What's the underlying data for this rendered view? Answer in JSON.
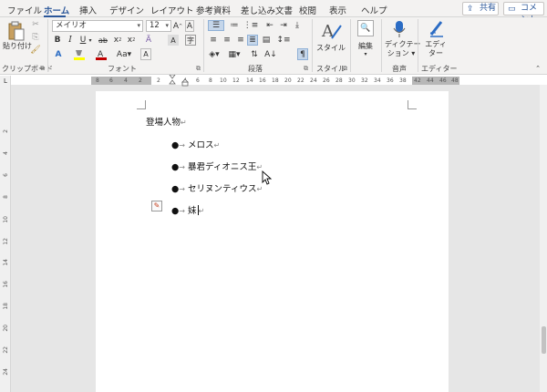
{
  "tabs": [
    "ファイル",
    "ホーム",
    "挿入",
    "デザイン",
    "レイアウト",
    "参考資料",
    "差し込み文書",
    "校閲",
    "表示",
    "ヘルプ"
  ],
  "active_tab": "ホーム",
  "share": {
    "label": "共有",
    "icon": "share-icon"
  },
  "comment": {
    "label": "コメント",
    "icon": "comment-icon"
  },
  "clipboard": {
    "paste_label": "貼り付け",
    "group_label": "クリップボード"
  },
  "font": {
    "name": "メイリオ",
    "size": "12",
    "group_label": "フォント"
  },
  "paragraph": {
    "group_label": "段落"
  },
  "styles": {
    "label": "スタイル",
    "group_label": "スタイル"
  },
  "editing": {
    "label": "編集"
  },
  "voice": {
    "label": "ディクテーション",
    "label_line1": "ディクテー",
    "label_line2": "ション",
    "group_label": "音声"
  },
  "editor": {
    "label": "エディター",
    "label_line1": "エディ",
    "label_line2": "ター",
    "group_label": "エディター"
  },
  "ruler": {
    "ticks_left": [
      "8",
      "6",
      "4",
      "2"
    ],
    "ticks": [
      "2",
      "4",
      "6",
      "8",
      "10",
      "12",
      "14",
      "16",
      "18",
      "20",
      "22",
      "24",
      "26",
      "28",
      "30",
      "32",
      "34",
      "36",
      "38"
    ],
    "ticks_right": [
      "42",
      "44",
      "46",
      "48"
    ]
  },
  "vruler": [
    "2",
    "4",
    "6",
    "8",
    "10",
    "12",
    "14",
    "16",
    "18",
    "20",
    "22",
    "24"
  ],
  "document": {
    "heading": "登場人物",
    "paragraph_mark": "↵",
    "bullet_items": [
      "メロス",
      "暴君ディオニス王",
      "セリヌンティウス",
      "妹"
    ],
    "bullet_glyph": "●",
    "arrow_glyph": "→"
  },
  "colors": {
    "accent": "#2b579a",
    "highlight": "#ffff00",
    "font_color": "#c00000"
  }
}
